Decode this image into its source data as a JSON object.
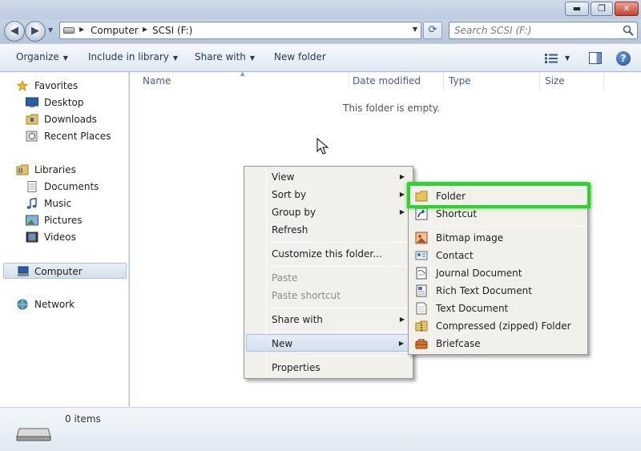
{
  "window": {
    "minimize_glyph": "▬",
    "maximize_glyph": "❐",
    "close_glyph": "✕"
  },
  "address": {
    "back_glyph": "◀",
    "forward_glyph": "▶",
    "history_glyph": "▼",
    "breadcrumbs": [
      "Computer",
      "SCSI (F:)"
    ],
    "crumb_separator": "▶",
    "dropdown_glyph": "▼",
    "refresh_glyph": "⟳",
    "search_placeholder": "Search SCSI (F:)"
  },
  "toolbar": {
    "organize": "Organize",
    "include_in_library": "Include in library",
    "share_with": "Share with",
    "new_folder": "New folder",
    "caret": "▼",
    "help": "?"
  },
  "nav": {
    "favorites": "Favorites",
    "desktop": "Desktop",
    "downloads": "Downloads",
    "recent_places": "Recent Places",
    "libraries": "Libraries",
    "documents": "Documents",
    "music": "Music",
    "pictures": "Pictures",
    "videos": "Videos",
    "computer": "Computer",
    "network": "Network"
  },
  "columns": {
    "name": "Name",
    "date_modified": "Date modified",
    "type": "Type",
    "size": "Size",
    "sort_glyph": "▲"
  },
  "content": {
    "empty_message": "This folder is empty."
  },
  "context_menu": {
    "submenu_arrow": "▶",
    "view": "View",
    "sort_by": "Sort by",
    "group_by": "Group by",
    "refresh": "Refresh",
    "customize": "Customize this folder...",
    "paste": "Paste",
    "paste_shortcut": "Paste shortcut",
    "share_with": "Share with",
    "new": "New",
    "properties": "Properties"
  },
  "new_submenu": {
    "folder": "Folder",
    "shortcut": "Shortcut",
    "bitmap_image": "Bitmap image",
    "contact": "Contact",
    "journal_document": "Journal Document",
    "rich_text_document": "Rich Text Document",
    "text_document": "Text Document",
    "compressed_folder": "Compressed (zipped) Folder",
    "briefcase": "Briefcase"
  },
  "status": {
    "item_count": "0 items"
  },
  "colors": {
    "highlight_green": "#2fd12f",
    "menu_background": "#f1f0ea",
    "selection_blue": "#d2dfef"
  }
}
